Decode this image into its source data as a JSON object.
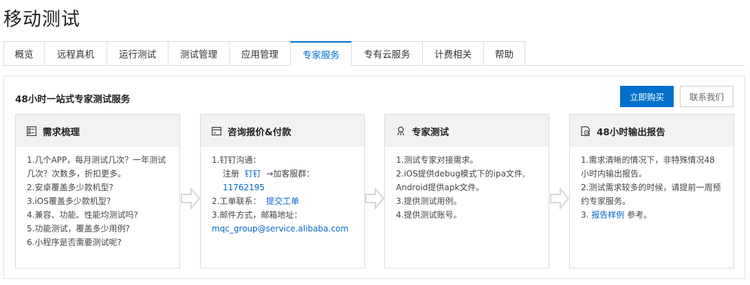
{
  "page": {
    "title": "移动测试"
  },
  "tabs": [
    {
      "label": "概览"
    },
    {
      "label": "远程真机"
    },
    {
      "label": "运行测试"
    },
    {
      "label": "测试管理"
    },
    {
      "label": "应用管理"
    },
    {
      "label": "专家服务"
    },
    {
      "label": "专有云服务"
    },
    {
      "label": "计费相关"
    },
    {
      "label": "帮助"
    }
  ],
  "active_tab": "专家服务",
  "panel": {
    "title": "48小时一站式专家测试服务",
    "buy_button": "立即购买",
    "contact_button": "联系我们"
  },
  "cards": [
    {
      "icon": "checklist-icon",
      "title": "需求梳理",
      "lines": [
        "1.几个APP，每月测试几次？一年测试",
        "几次？次数多，折扣更多。",
        "2.安卓覆盖多少款机型?",
        "3.iOS覆盖多少款机型?",
        "4.兼容、功能、性能均测试吗?",
        "5.功能测试，覆盖多少用例?",
        "6.小程序是否需要测试呢?"
      ]
    },
    {
      "icon": "payment-card-icon",
      "title": "咨询报价&付款",
      "line1": "1.钉钉沟通：",
      "register_prefix": "注册",
      "dingtalk_link": "钉钉",
      "register_suffix": "→加客服群：",
      "group_number": "11762195",
      "ticket_prefix": "2.工单联系：",
      "ticket_link": "提交工单",
      "mail_line": "3.邮件方式，邮箱地址：",
      "email": "mqc_group@service.alibaba.com"
    },
    {
      "icon": "expert-icon",
      "title": "专家测试",
      "lines": [
        "1.测试专家对接需求。",
        "2.iOS提供debug模式下的ipa文件,",
        "Android提供apk文件。",
        "3.提供测试用例。",
        "4.提供测试账号。"
      ]
    },
    {
      "icon": "report-icon",
      "title": "48小时输出报告",
      "lines": [
        "1.需求清晰的情况下，非特殊情况48",
        "小时内输出报告。",
        "2.测试需求较多的时候，请提前一周预",
        "约专家服务。"
      ],
      "example_prefix": "3.",
      "example_link": "报告样例",
      "example_suffix": "参考。"
    }
  ],
  "colors": {
    "accent": "#0070cc",
    "link": "#0066cc",
    "card_header": "#f2f2f2",
    "border": "#dcdcdc"
  }
}
